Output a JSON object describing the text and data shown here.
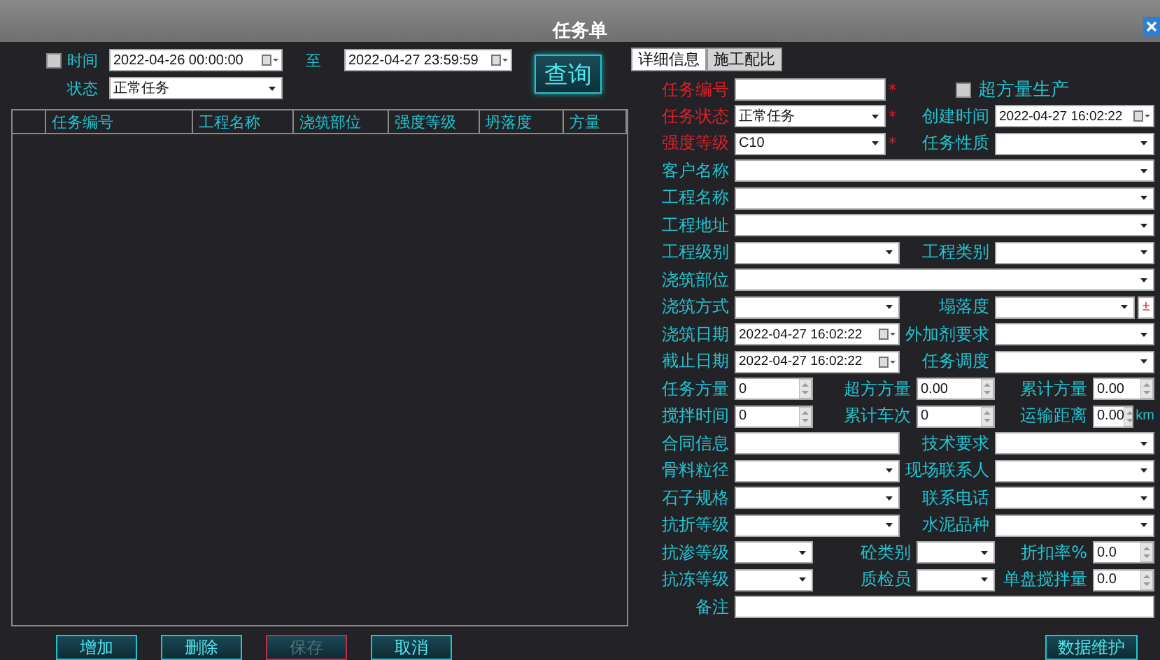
{
  "window": {
    "title": "任务单"
  },
  "filter": {
    "time_label": "时间",
    "time_checked": false,
    "from": "2022-04-26 00:00:00",
    "separator": "至",
    "to": "2022-04-27 23:59:59",
    "status_label": "状态",
    "status_value": "正常任务",
    "query_button": "查询"
  },
  "table": {
    "columns": [
      "任务编号",
      "工程名称",
      "浇筑部位",
      "强度等级",
      "坍落度",
      "方量"
    ]
  },
  "buttons": [
    {
      "label": "增加",
      "disabled": false
    },
    {
      "label": "删除",
      "disabled": false
    },
    {
      "label": "保存",
      "disabled": true
    },
    {
      "label": "取消",
      "disabled": false
    }
  ],
  "tabs": [
    {
      "label": "详细信息",
      "selected": true
    },
    {
      "label": "施工配比",
      "selected": false
    }
  ],
  "form": {
    "rows": [
      [
        {
          "label": "任务编号",
          "kind": "text",
          "required": true,
          "mark": "*"
        },
        {
          "label": "超方量生产",
          "kind": "checkbox",
          "required": false,
          "checked": false
        }
      ],
      [
        {
          "label": "任务状态",
          "kind": "select",
          "required": true,
          "value": "正常任务",
          "mark": "*"
        },
        {
          "label": "创建时间",
          "kind": "date",
          "required": false,
          "value": "2022-04-27 16:02:22"
        }
      ],
      [
        {
          "label": "强度等级",
          "kind": "select",
          "required": true,
          "value": "C10",
          "mark": "*"
        },
        {
          "label": "任务性质",
          "kind": "select",
          "required": false
        }
      ],
      [
        {
          "label": "客户名称",
          "kind": "select",
          "required": false
        }
      ],
      [
        {
          "label": "工程名称",
          "kind": "select",
          "required": false
        }
      ],
      [
        {
          "label": "工程地址",
          "kind": "select",
          "required": false
        }
      ],
      [
        {
          "label": "工程级别",
          "kind": "select",
          "required": false
        },
        {
          "label": "工程类别",
          "kind": "select",
          "required": false
        }
      ],
      [
        {
          "label": "浇筑部位",
          "kind": "select",
          "required": false
        }
      ],
      [
        {
          "label": "浇筑方式",
          "kind": "select",
          "required": false
        },
        {
          "label": "塌落度",
          "kind": "select",
          "required": false,
          "extra_button": "±"
        }
      ],
      [
        {
          "label": "浇筑日期",
          "kind": "date",
          "required": false,
          "value": "2022-04-27 16:02:22"
        },
        {
          "label": "外加剂要求",
          "kind": "select",
          "required": false
        }
      ],
      [
        {
          "label": "截止日期",
          "kind": "date",
          "required": false,
          "value": "2022-04-27 16:02:22"
        },
        {
          "label": "任务调度",
          "kind": "select",
          "required": false
        }
      ],
      [
        {
          "label": "任务方量",
          "kind": "spin",
          "required": false,
          "value": "0"
        },
        {
          "label": "超方方量",
          "kind": "spin",
          "required": false,
          "value": "0.00"
        },
        {
          "label": "累计方量",
          "kind": "spin",
          "required": false,
          "value": "0.00"
        }
      ],
      [
        {
          "label": "搅拌时间",
          "kind": "spin",
          "required": false,
          "value": "0"
        },
        {
          "label": "累计车次",
          "kind": "spin",
          "required": false,
          "value": "0"
        },
        {
          "label": "运输距离",
          "kind": "spin",
          "required": false,
          "value": "0.00",
          "unit": "km"
        }
      ],
      [
        {
          "label": "合同信息",
          "kind": "text",
          "required": false
        },
        {
          "label": "技术要求",
          "kind": "select",
          "required": false
        }
      ],
      [
        {
          "label": "骨料粒径",
          "kind": "select",
          "required": false
        },
        {
          "label": "现场联系人",
          "kind": "select",
          "required": false
        }
      ],
      [
        {
          "label": "石子规格",
          "kind": "select",
          "required": false
        },
        {
          "label": "联系电话",
          "kind": "select",
          "required": false
        }
      ],
      [
        {
          "label": "抗折等级",
          "kind": "select",
          "required": false
        },
        {
          "label": "水泥品种",
          "kind": "select",
          "required": false
        }
      ],
      [
        {
          "label": "抗渗等级",
          "kind": "select",
          "required": false
        },
        {
          "label": "砼类别",
          "kind": "select",
          "required": false
        },
        {
          "label": "折扣率%",
          "kind": "spin",
          "required": false,
          "value": "0.0"
        }
      ],
      [
        {
          "label": "抗冻等级",
          "kind": "select",
          "required": false
        },
        {
          "label": "质检员",
          "kind": "select",
          "required": false
        },
        {
          "label": "单盘搅拌量",
          "kind": "spin",
          "required": false,
          "value": "0.0"
        }
      ],
      [
        {
          "label": "备注",
          "kind": "text",
          "required": false
        }
      ]
    ]
  },
  "maintenance_button": "数据维护"
}
